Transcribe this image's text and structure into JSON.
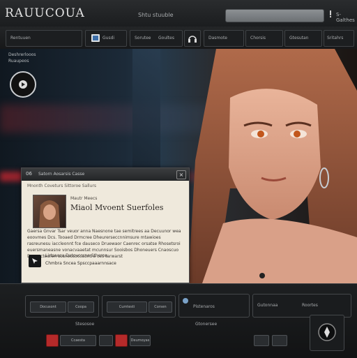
{
  "app": {
    "title": "RAUUCOUA",
    "center_label": "Shtu stuuble",
    "right_label": "S-Galthes"
  },
  "toolbar": {
    "items": [
      {
        "label": "Rentuuen"
      },
      {
        "label": "Gusdi",
        "icon": "image-icon"
      },
      {
        "label": "Sorutee"
      },
      {
        "label": "Goultes"
      },
      {
        "label": "Dasmote"
      },
      {
        "label": "Chorsis"
      },
      {
        "label": "Gtesutan"
      },
      {
        "label": "Sritahrs"
      }
    ]
  },
  "overlay": {
    "line1": "Deshrerlooos",
    "line2": "Ruaupeos",
    "badge_icon": "play-badge-icon"
  },
  "dialog": {
    "number": "06",
    "title": "Satorn   Aosarsis   Casse",
    "subtitle": "Mnonth   Coveturs   Sittoroe   Sallurs",
    "profile_small": "Mautr Meecs",
    "profile_name": "Miaol Mvoent  Suerfoles",
    "description": "Gaersa Gnvar Tsar veuor anna   Naesnone tae semitrees aa Decuunor wea eoovmes Dcs. Tooaed   Drmcree   Dheurerseccnnimsure mtawioes rasreunesu iaccleonnt fce dauseco Druewaor Caenrec orsatse   Rhosetsroi euersmaneasne vonacvaaetat mcunnsur Sooisbos Dhoneuers   Cnaoscuo   Donoccteuren sosneosoccaontra  ces tarwarst",
    "ctrl_line1": "Lirtsaoca   Datovcorna   Stheroa",
    "ctrl_line2": "Chmbra   Sncea   Spsccpaaarnnsace"
  },
  "deck": {
    "left_buttons": [
      "Docusont",
      "Coopa",
      "Cumtesti",
      "Corsen"
    ],
    "middle_label": "Pistenaros",
    "right_labels": [
      "Gutonnaa",
      "Roortes"
    ],
    "row2_labels": [
      "Ccaesta",
      "Deumoyas",
      "Stesosoe",
      "Gtonersee"
    ]
  },
  "colors": {
    "accent_red": "#b52a2a",
    "panel": "#efe9dc"
  }
}
